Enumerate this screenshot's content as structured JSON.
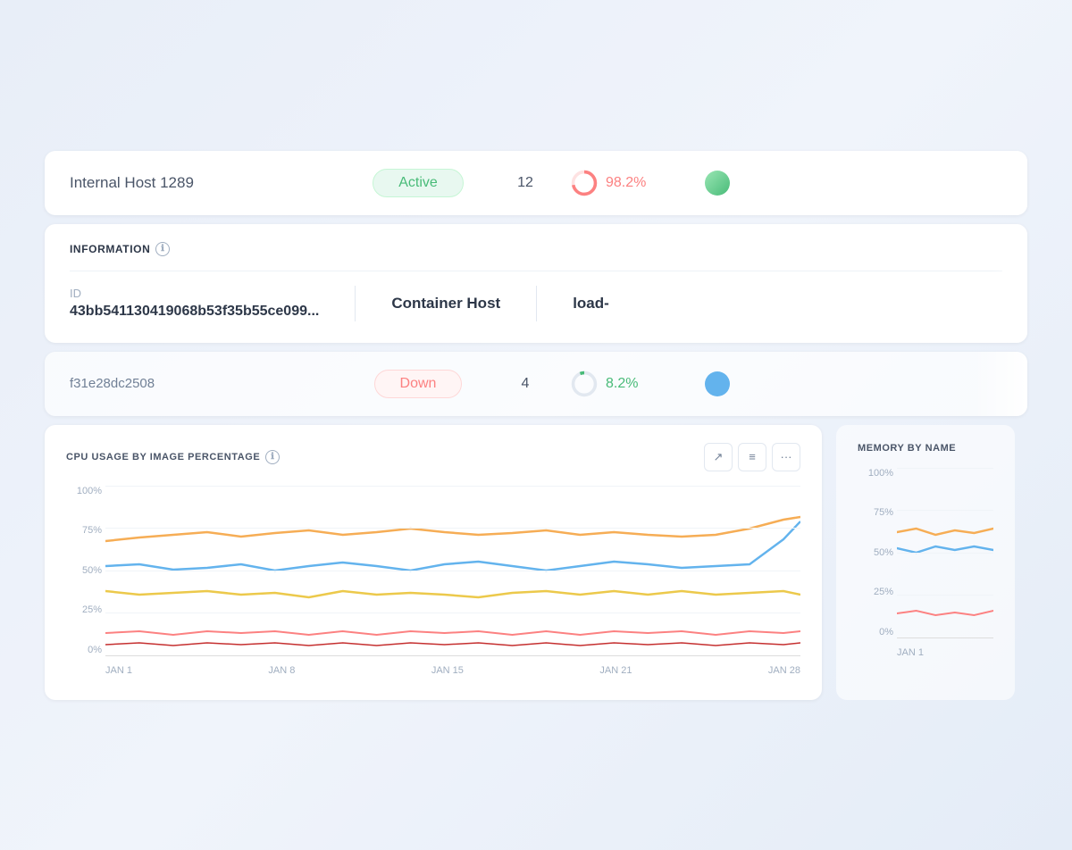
{
  "rows": {
    "row1": {
      "name": "Internal Host 1289",
      "status": "Active",
      "count": "12",
      "cpu_pct": "98.2%"
    },
    "row2": {
      "name": "f31e28dc2508",
      "status": "Down",
      "count": "4",
      "cpu_pct": "8.2%"
    }
  },
  "info": {
    "section_title": "INFORMATION",
    "id_label": "ID",
    "id_value": "43bb541130419068b53f35b55ce099...",
    "host_label": "Container Host",
    "host_value": "load-",
    "info_icon": "ℹ"
  },
  "cpu_chart": {
    "title": "CPU USAGE BY IMAGE PERCENTAGE",
    "info_icon": "ℹ",
    "y_labels": [
      "100%",
      "75%",
      "50%",
      "25%",
      "0%"
    ],
    "x_labels": [
      "JAN 1",
      "JAN 8",
      "JAN 15",
      "JAN 21",
      "JAN 28"
    ],
    "btn_expand": "↗",
    "btn_filter": "≡",
    "btn_more": "···"
  },
  "memory_chart": {
    "title": "MEMORY BY NAME",
    "y_labels": [
      "100%",
      "75%",
      "50%",
      "25%",
      "0%"
    ],
    "x_labels": [
      "JAN 1"
    ]
  }
}
